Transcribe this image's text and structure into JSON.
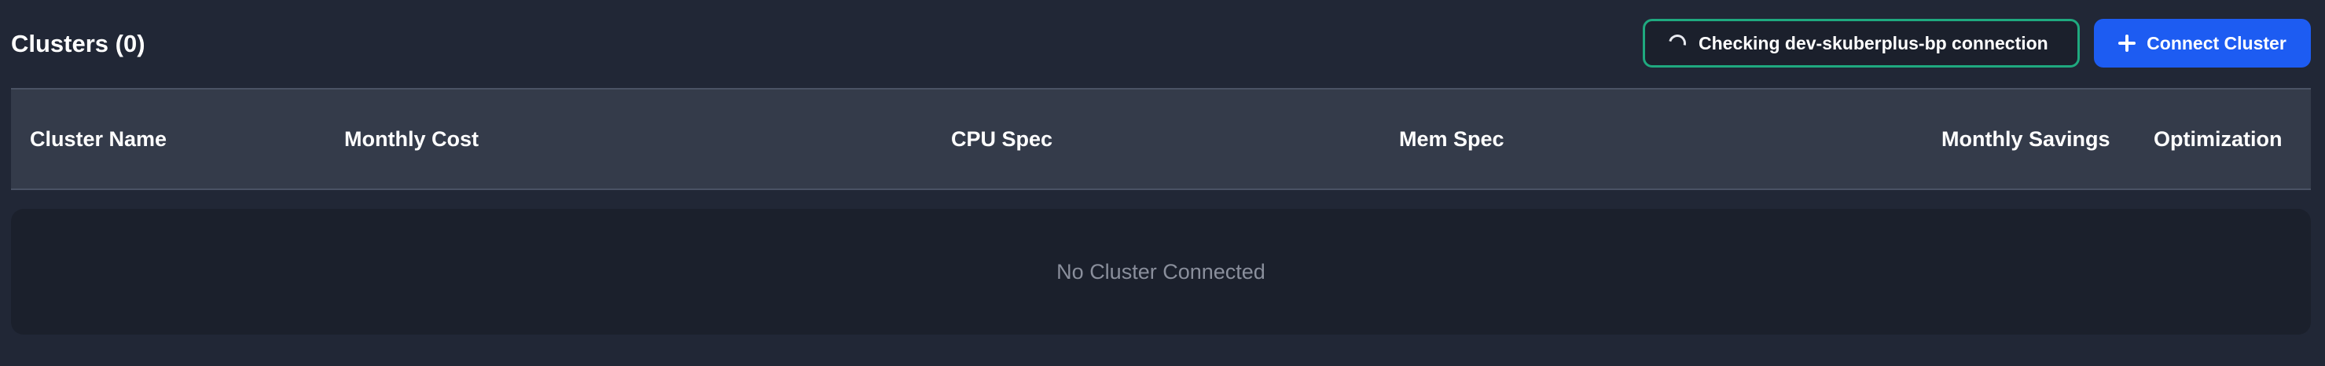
{
  "header": {
    "title": "Clusters (0)"
  },
  "status": {
    "text": "Checking dev-skuberplus-bp connection",
    "icon": "spinner-icon",
    "border_color": "#1fa97f"
  },
  "connect_button": {
    "label": "Connect Cluster",
    "icon": "plus-icon",
    "color": "#1d5cf2"
  },
  "table": {
    "columns": [
      "Cluster Name",
      "Monthly Cost",
      "CPU Spec",
      "Mem Spec",
      "Monthly Savings",
      "Optimization"
    ],
    "rows": [],
    "empty_message": "No Cluster Connected"
  }
}
